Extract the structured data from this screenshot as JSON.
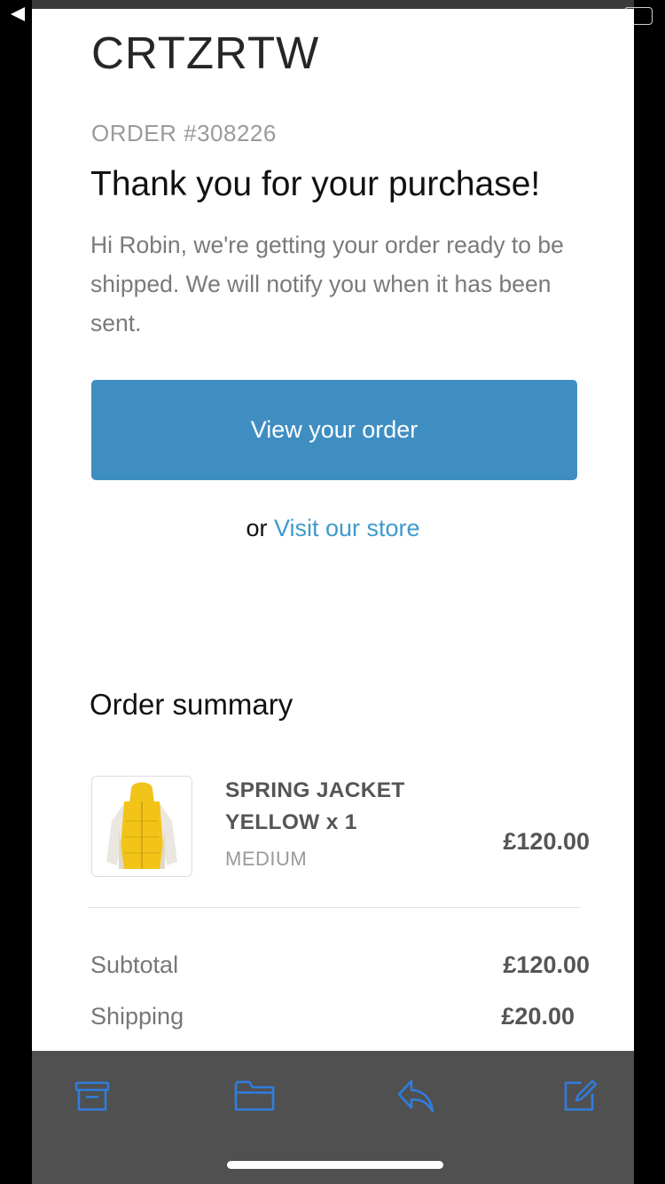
{
  "email": {
    "brand": "CRTZRTW",
    "order_number": "ORDER #308226",
    "headline": "Thank you for your purchase!",
    "intro": "Hi Robin, we're getting your order ready to be shipped. We will notify you when it has been sent.",
    "view_order_label": "View your order",
    "store_prefix": "or",
    "store_link_label": "Visit our store"
  },
  "summary": {
    "title": "Order summary",
    "items": [
      {
        "name": "SPRING JACKET YELLOW x 1",
        "variant": "MEDIUM",
        "price": "£120.00",
        "image_icon": "yellow-jacket-thumbnail"
      }
    ],
    "subtotal_label": "Subtotal",
    "subtotal_value": "£120.00",
    "shipping_label": "Shipping",
    "shipping_value": "£20.00"
  },
  "toolbar": {
    "icons": [
      "archive-icon",
      "folder-icon",
      "reply-icon",
      "compose-icon"
    ],
    "icon_color": "#2f7de0"
  },
  "colors": {
    "button": "#3f8ec2",
    "link": "#3f9acd",
    "toolbar_bg": "#505050"
  }
}
